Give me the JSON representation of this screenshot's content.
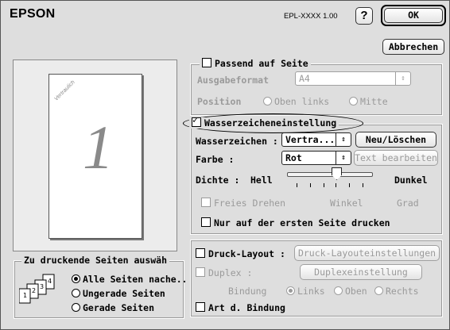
{
  "header": {
    "brand": "EPSON",
    "model": "EPL-XXXX  1.00",
    "help_label": "?",
    "ok_label": "OK",
    "cancel_label": "Abbrechen"
  },
  "preview": {
    "page_number": "1",
    "watermark": "Vertraulich"
  },
  "fit_group": {
    "title": "Passend auf Seite",
    "checked": false,
    "output_label": "Ausgabeformat",
    "output_value": "A4",
    "position_label": "Position",
    "position_options": [
      "Oben links",
      "Mitte"
    ]
  },
  "watermark_group": {
    "title": "Wasserzeicheneinstellung",
    "checked": true,
    "watermark_label": "Wasserzeichen :",
    "watermark_value": "Vertra...",
    "new_delete_label": "Neu/Löschen",
    "color_label": "Farbe :",
    "color_value": "Rot",
    "edit_text_label": "Text bearbeiten",
    "density_label": "Dichte :",
    "density_low": "Hell",
    "density_high": "Dunkel",
    "density_level": 0.6,
    "free_rotate_label": "Freies Drehen",
    "angle_label": "Winkel",
    "degree_label": "Grad",
    "first_page_only_label": "Nur auf der ersten Seite drucken"
  },
  "layout_group": {
    "print_layout_label": "Druck-Layout :",
    "print_layout_button": "Druck-Layouteinstellungen",
    "duplex_label": "Duplex :",
    "duplex_button": "Duplexeinstellung",
    "binding_label": "Bindung",
    "binding_options": [
      "Links",
      "Oben",
      "Rechts"
    ],
    "binding_type_label": "Art d. Bindung"
  },
  "pages_group": {
    "title": "Zu druckende Seiten auswäh",
    "options": [
      "Alle Seiten nache..",
      "Ungerade Seiten",
      "Gerade Seiten"
    ],
    "selected_index": 0,
    "icon_numbers": [
      "1",
      "2",
      "3",
      "4"
    ]
  }
}
